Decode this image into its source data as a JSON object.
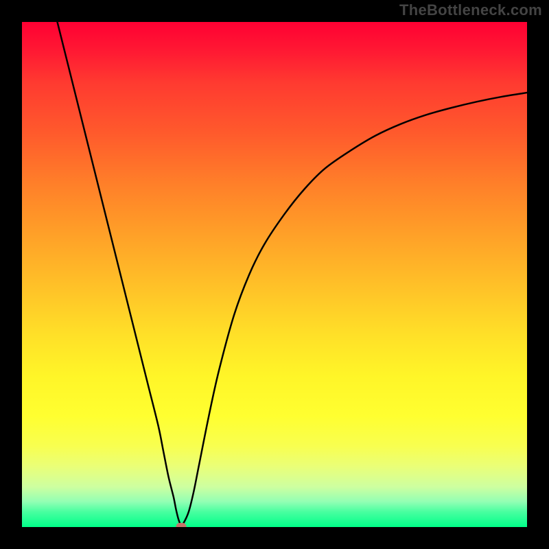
{
  "watermark": "TheBottleneck.com",
  "chart_data": {
    "type": "line",
    "title": "",
    "xlabel": "",
    "ylabel": "",
    "xlim": [
      0,
      100
    ],
    "ylim": [
      0,
      100
    ],
    "grid": false,
    "series": [
      {
        "name": "curve",
        "x": [
          7,
          9,
          11,
          13,
          15,
          17,
          19,
          21,
          23,
          25,
          27,
          28,
          29,
          30,
          30.5,
          31,
          31.5,
          32,
          33,
          34,
          35,
          37,
          39,
          42,
          45,
          48,
          52,
          56,
          60,
          65,
          70,
          75,
          80,
          85,
          90,
          95,
          100
        ],
        "values": [
          100,
          92,
          84,
          76,
          68,
          60,
          52,
          44,
          36,
          28,
          20,
          15,
          10,
          6,
          3.5,
          1.5,
          0.4,
          0.8,
          3,
          7,
          12,
          22,
          31,
          42,
          50,
          56,
          62,
          67,
          71,
          74.5,
          77.5,
          79.8,
          81.6,
          83,
          84.2,
          85.2,
          86
        ]
      }
    ],
    "marker": {
      "x": 31.5,
      "y": 0.2
    },
    "background_gradient_stops": [
      {
        "pos": 0,
        "color": "#ff0033"
      },
      {
        "pos": 50,
        "color": "#ffc028"
      },
      {
        "pos": 80,
        "color": "#ffff30"
      },
      {
        "pos": 100,
        "color": "#00ff89"
      }
    ]
  }
}
